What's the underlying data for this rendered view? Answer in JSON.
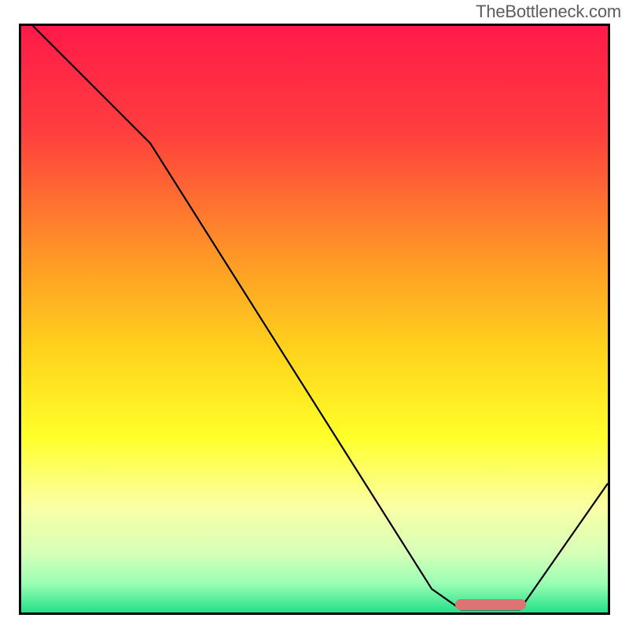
{
  "watermark": "TheBottleneck.com",
  "chart_data": {
    "type": "line",
    "title": "",
    "xlabel": "",
    "ylabel": "",
    "xlim": [
      0,
      100
    ],
    "ylim": [
      0,
      100
    ],
    "gradient_stops": [
      {
        "offset": 0,
        "color": "#ff1a49"
      },
      {
        "offset": 18,
        "color": "#ff3e3e"
      },
      {
        "offset": 40,
        "color": "#ff9a26"
      },
      {
        "offset": 55,
        "color": "#ffd21c"
      },
      {
        "offset": 70,
        "color": "#ffff2a"
      },
      {
        "offset": 82,
        "color": "#faffa6"
      },
      {
        "offset": 90,
        "color": "#d6ffb8"
      },
      {
        "offset": 95,
        "color": "#9bffb4"
      },
      {
        "offset": 100,
        "color": "#25e08a"
      }
    ],
    "series": [
      {
        "name": "bottleneck-curve",
        "points": [
          {
            "x": 2,
            "y": 100
          },
          {
            "x": 22,
            "y": 80
          },
          {
            "x": 70,
            "y": 4
          },
          {
            "x": 75,
            "y": 0.5
          },
          {
            "x": 85,
            "y": 0.5
          },
          {
            "x": 100,
            "y": 22
          }
        ]
      }
    ],
    "optimal_marker": {
      "x_start": 74,
      "x_end": 86,
      "y": 1
    }
  }
}
